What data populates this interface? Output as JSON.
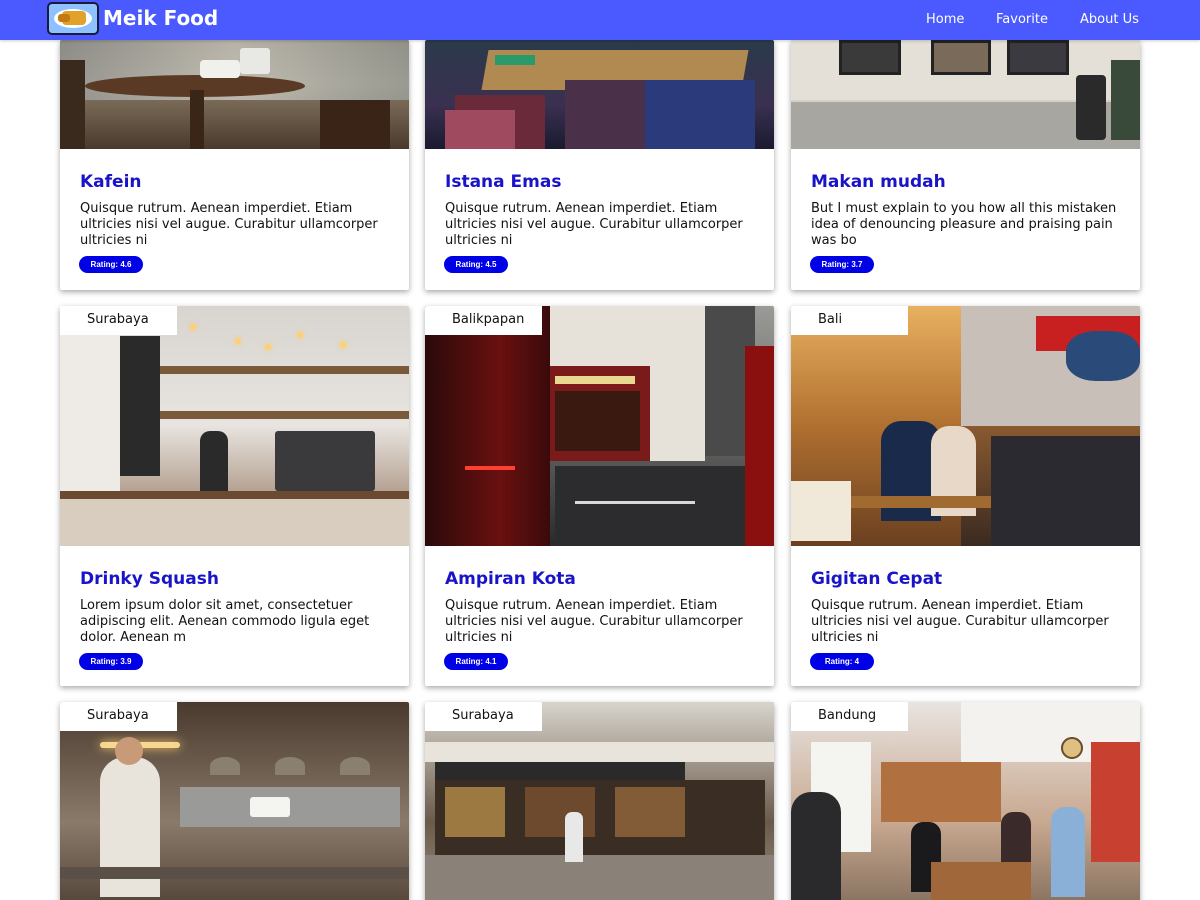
{
  "navbar": {
    "brand": "Meik Food",
    "links": [
      "Home",
      "Favorite",
      "About Us"
    ]
  },
  "colors": {
    "navbar": "#4a5aff",
    "title": "#1a14c8",
    "badge": "#0000e6"
  },
  "cards": [
    {
      "title": "Kafein",
      "description": "Quisque rutrum. Aenean imperdiet. Etiam ultricies nisi vel augue. Curabitur ullamcorper ultricies ni",
      "rating": "Rating: 4.6"
    },
    {
      "title": "Istana Emas",
      "description": "Quisque rutrum. Aenean imperdiet. Etiam ultricies nisi vel augue. Curabitur ullamcorper ultricies ni",
      "rating": "Rating: 4.5"
    },
    {
      "title": "Makan mudah",
      "description": "But I must explain to you how all this mistaken idea of denouncing pleasure and praising pain was bo",
      "rating": "Rating: 3.7"
    },
    {
      "city": "Surabaya",
      "title": "Drinky Squash",
      "description": "Lorem ipsum dolor sit amet, consectetuer adipiscing elit. Aenean commodo ligula eget dolor. Aenean m",
      "rating": "Rating: 3.9"
    },
    {
      "city": "Balikpapan",
      "title": "Ampiran Kota",
      "description": "Quisque rutrum. Aenean imperdiet. Etiam ultricies nisi vel augue. Curabitur ullamcorper ultricies ni",
      "rating": "Rating: 4.1"
    },
    {
      "city": "Bali",
      "title": "Gigitan Cepat",
      "description": "Quisque rutrum. Aenean imperdiet. Etiam ultricies nisi vel augue. Curabitur ullamcorper ultricies ni",
      "rating": "Rating: 4"
    },
    {
      "city": "Surabaya"
    },
    {
      "city": "Surabaya"
    },
    {
      "city": "Bandung"
    }
  ]
}
